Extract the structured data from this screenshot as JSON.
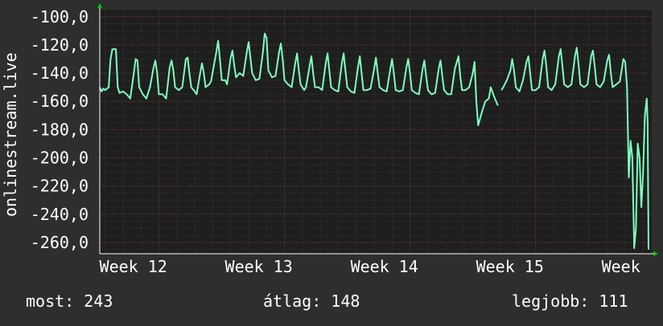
{
  "chart_data": {
    "type": "line",
    "title": "",
    "xlabel": "",
    "ylabel": "onlinestream.live",
    "ylim": [
      -268,
      -95
    ],
    "y_ticks": [
      -100,
      -120,
      -140,
      -160,
      -180,
      -200,
      -220,
      -240,
      -260
    ],
    "y_tick_labels": [
      "-100,0",
      "-120,0",
      "-140,0",
      "-160,0",
      "-180,0",
      "-200,0",
      "-220,0",
      "-240,0",
      "-260,0"
    ],
    "x_ticks": [
      {
        "label": "Week 12",
        "day": 3.3
      },
      {
        "label": "Week 13",
        "day": 10.3
      },
      {
        "label": "Week 14",
        "day": 17.3
      },
      {
        "label": "Week 15",
        "day": 24.3
      },
      {
        "label": "Week",
        "day": 31.3
      }
    ],
    "xlim": [
      0,
      30.6
    ],
    "grid": true,
    "colors": {
      "background": "#2e2e2e",
      "plot": "#1e1e1e",
      "line": "#7fffbf",
      "grid_minor": "#3a3a3a",
      "grid_major": "#5a2a2a",
      "axis_arrow": "#00cc00"
    },
    "series": [
      {
        "values": [
          [
            0.0,
            -150
          ],
          [
            0.1,
            -153
          ],
          [
            0.2,
            -151
          ],
          [
            0.3,
            -152
          ],
          [
            0.5,
            -150
          ],
          [
            0.6,
            -130
          ],
          [
            0.7,
            -123
          ],
          [
            0.9,
            -123
          ],
          [
            1.0,
            -150
          ],
          [
            1.1,
            -154
          ],
          [
            1.3,
            -153
          ],
          [
            1.5,
            -155
          ],
          [
            1.7,
            -158
          ],
          [
            1.9,
            -140
          ],
          [
            2.0,
            -130
          ],
          [
            2.1,
            -131
          ],
          [
            2.2,
            -150
          ],
          [
            2.4,
            -155
          ],
          [
            2.6,
            -158
          ],
          [
            2.8,
            -150
          ],
          [
            3.0,
            -136
          ],
          [
            3.1,
            -131
          ],
          [
            3.2,
            -140
          ],
          [
            3.3,
            -155
          ],
          [
            3.5,
            -155
          ],
          [
            3.7,
            -158
          ],
          [
            3.9,
            -136
          ],
          [
            4.0,
            -131
          ],
          [
            4.1,
            -138
          ],
          [
            4.2,
            -150
          ],
          [
            4.4,
            -152
          ],
          [
            4.6,
            -150
          ],
          [
            4.8,
            -130
          ],
          [
            4.9,
            -129
          ],
          [
            5.0,
            -140
          ],
          [
            5.1,
            -150
          ],
          [
            5.3,
            -153
          ],
          [
            5.4,
            -155
          ],
          [
            5.6,
            -140
          ],
          [
            5.7,
            -133
          ],
          [
            5.8,
            -140
          ],
          [
            5.9,
            -150
          ],
          [
            6.1,
            -148
          ],
          [
            6.2,
            -146
          ],
          [
            6.5,
            -125
          ],
          [
            6.6,
            -117
          ],
          [
            6.7,
            -130
          ],
          [
            6.8,
            -145
          ],
          [
            7.0,
            -145
          ],
          [
            7.1,
            -148
          ],
          [
            7.3,
            -129
          ],
          [
            7.4,
            -124
          ],
          [
            7.5,
            -135
          ],
          [
            7.6,
            -143
          ],
          [
            7.8,
            -140
          ],
          [
            8.0,
            -142
          ],
          [
            8.2,
            -125
          ],
          [
            8.3,
            -118
          ],
          [
            8.4,
            -129
          ],
          [
            8.5,
            -140
          ],
          [
            8.7,
            -145
          ],
          [
            8.9,
            -144
          ],
          [
            9.1,
            -125
          ],
          [
            9.2,
            -112
          ],
          [
            9.3,
            -115
          ],
          [
            9.4,
            -138
          ],
          [
            9.6,
            -143
          ],
          [
            9.8,
            -142
          ],
          [
            10.0,
            -125
          ],
          [
            10.1,
            -119
          ],
          [
            10.2,
            -130
          ],
          [
            10.3,
            -145
          ],
          [
            10.5,
            -148
          ],
          [
            10.7,
            -150
          ],
          [
            10.9,
            -133
          ],
          [
            11.0,
            -126
          ],
          [
            11.1,
            -138
          ],
          [
            11.2,
            -148
          ],
          [
            11.4,
            -152
          ],
          [
            11.5,
            -150
          ],
          [
            11.7,
            -135
          ],
          [
            11.8,
            -128
          ],
          [
            11.9,
            -140
          ],
          [
            12.0,
            -150
          ],
          [
            12.2,
            -150
          ],
          [
            12.4,
            -152
          ],
          [
            12.6,
            -133
          ],
          [
            12.7,
            -126
          ],
          [
            12.8,
            -138
          ],
          [
            12.9,
            -150
          ],
          [
            13.1,
            -152
          ],
          [
            13.3,
            -153
          ],
          [
            13.5,
            -133
          ],
          [
            13.6,
            -126
          ],
          [
            13.7,
            -138
          ],
          [
            13.8,
            -150
          ],
          [
            14.0,
            -153
          ],
          [
            14.2,
            -154
          ],
          [
            14.4,
            -136
          ],
          [
            14.5,
            -128
          ],
          [
            14.6,
            -140
          ],
          [
            14.7,
            -152
          ],
          [
            14.9,
            -152
          ],
          [
            15.1,
            -151
          ],
          [
            15.3,
            -137
          ],
          [
            15.4,
            -129
          ],
          [
            15.5,
            -140
          ],
          [
            15.6,
            -150
          ],
          [
            15.8,
            -152
          ],
          [
            16.0,
            -153
          ],
          [
            16.2,
            -137
          ],
          [
            16.3,
            -130
          ],
          [
            16.4,
            -140
          ],
          [
            16.5,
            -152
          ],
          [
            16.7,
            -153
          ],
          [
            16.9,
            -152
          ],
          [
            17.1,
            -136
          ],
          [
            17.2,
            -130
          ],
          [
            17.3,
            -140
          ],
          [
            17.4,
            -152
          ],
          [
            17.6,
            -154
          ],
          [
            17.8,
            -155
          ],
          [
            18.0,
            -137
          ],
          [
            18.1,
            -131
          ],
          [
            18.2,
            -142
          ],
          [
            18.3,
            -152
          ],
          [
            18.5,
            -155
          ],
          [
            18.7,
            -154
          ],
          [
            18.9,
            -137
          ],
          [
            19.0,
            -131
          ],
          [
            19.1,
            -142
          ],
          [
            19.2,
            -152
          ],
          [
            19.4,
            -155
          ],
          [
            19.6,
            -155
          ],
          [
            19.8,
            -137
          ],
          [
            20.0,
            -128
          ],
          [
            20.1,
            -142
          ],
          [
            20.2,
            -152
          ],
          [
            20.4,
            -152
          ],
          [
            20.6,
            -150
          ],
          [
            20.8,
            -140
          ],
          [
            20.9,
            -132
          ],
          [
            21.0,
            -160
          ],
          [
            21.1,
            -177
          ],
          [
            21.3,
            -168
          ],
          [
            21.5,
            -160
          ],
          [
            21.7,
            -158
          ],
          [
            21.8,
            -150
          ],
          [
            22.0,
            -157
          ],
          [
            22.2,
            -163
          ],
          [
            22.3,
            null
          ],
          [
            22.4,
            -152
          ],
          [
            22.5,
            -150
          ],
          [
            22.7,
            -145
          ],
          [
            22.9,
            -138
          ],
          [
            23.0,
            -130
          ],
          [
            23.1,
            -138
          ],
          [
            23.2,
            -150
          ],
          [
            23.4,
            -153
          ],
          [
            23.6,
            -145
          ],
          [
            23.8,
            -132
          ],
          [
            23.9,
            -128
          ],
          [
            24.0,
            -140
          ],
          [
            24.1,
            -152
          ],
          [
            24.3,
            -152
          ],
          [
            24.5,
            -150
          ],
          [
            24.7,
            -130
          ],
          [
            24.8,
            -124
          ],
          [
            24.9,
            -135
          ],
          [
            25.0,
            -150
          ],
          [
            25.2,
            -152
          ],
          [
            25.4,
            -148
          ],
          [
            25.6,
            -128
          ],
          [
            25.7,
            -123
          ],
          [
            25.8,
            -135
          ],
          [
            25.9,
            -148
          ],
          [
            26.1,
            -150
          ],
          [
            26.3,
            -148
          ],
          [
            26.5,
            -128
          ],
          [
            26.6,
            -122
          ],
          [
            26.7,
            -134
          ],
          [
            26.8,
            -148
          ],
          [
            27.0,
            -150
          ],
          [
            27.2,
            -148
          ],
          [
            27.4,
            -128
          ],
          [
            27.5,
            -124
          ],
          [
            27.6,
            -135
          ],
          [
            27.7,
            -148
          ],
          [
            27.9,
            -150
          ],
          [
            28.1,
            -146
          ],
          [
            28.3,
            -131
          ],
          [
            28.4,
            -127
          ],
          [
            28.5,
            -140
          ],
          [
            28.6,
            -150
          ],
          [
            28.8,
            -148
          ],
          [
            29.0,
            -146
          ],
          [
            29.2,
            -130
          ],
          [
            29.3,
            -132
          ],
          [
            29.4,
            -150
          ],
          [
            29.5,
            -214
          ],
          [
            29.6,
            -188
          ],
          [
            29.7,
            -200
          ],
          [
            29.8,
            -264
          ],
          [
            29.9,
            -250
          ],
          [
            30.0,
            -190
          ],
          [
            30.1,
            -200
          ],
          [
            30.2,
            -235
          ],
          [
            30.3,
            -210
          ],
          [
            30.4,
            -170
          ],
          [
            30.5,
            -158
          ],
          [
            30.55,
            -175
          ],
          [
            30.6,
            -265
          ]
        ]
      }
    ],
    "gap_segment_days": [
      [
        5.0,
        6.0
      ]
    ]
  },
  "footer": {
    "most": "most: 243",
    "atlag": "átlag: 148",
    "legjobb": "legjobb: 111"
  }
}
